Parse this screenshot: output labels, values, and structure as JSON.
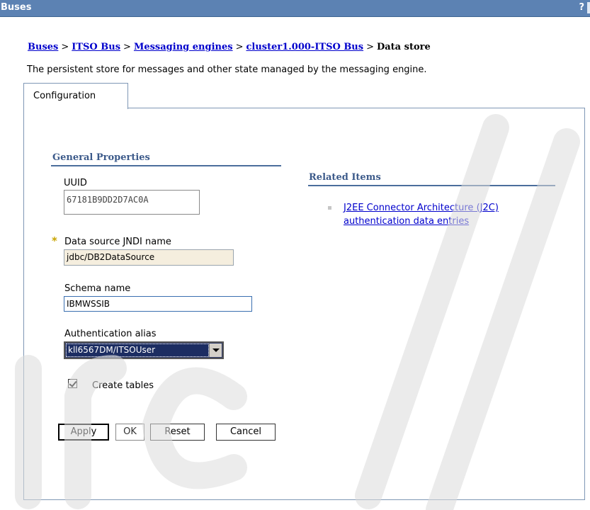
{
  "window": {
    "title": "Buses",
    "help": "?"
  },
  "breadcrumb": {
    "items": [
      "Buses",
      "ITSO Bus",
      "Messaging engines",
      "cluster1.000-ITSO Bus"
    ],
    "separator": ">",
    "current": "Data store"
  },
  "description": "The persistent store for messages and other state managed by the messaging engine.",
  "tabs": [
    {
      "label": "Configuration",
      "active": true
    }
  ],
  "general_properties": {
    "heading": "General Properties",
    "uuid": {
      "label": "UUID",
      "value": "67181B9DD2D7AC0A"
    },
    "data_source": {
      "required_marker": "*",
      "label": "Data source JNDI name",
      "value": "jdbc/DB2DataSource"
    },
    "schema": {
      "label": "Schema name",
      "value": "IBMWSSIB"
    },
    "auth_alias": {
      "label": "Authentication alias",
      "selected": "kll6567DM/ITSOUser"
    },
    "create_tables": {
      "label": "Create tables",
      "checked": true
    }
  },
  "buttons": {
    "apply": "Apply",
    "ok": "OK",
    "reset": "Reset",
    "cancel": "Cancel"
  },
  "related_items": {
    "heading": "Related Items",
    "links": [
      "J2EE Connector Architecture (J2C) authentication data entries"
    ]
  },
  "colors": {
    "titlebar": "#5c82b3",
    "link": "#0000cc",
    "section_heading": "#3c5a8a",
    "required_star": "#c8a400"
  }
}
